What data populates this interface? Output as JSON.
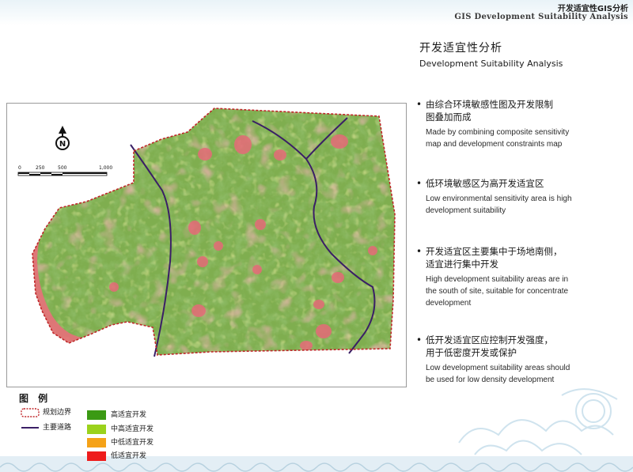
{
  "header": {
    "title_cn": "开发适宜性GIS分析",
    "title_en": "GIS Development Suitability  Analysis"
  },
  "main": {
    "title_cn": "开发适宜性分析",
    "title_en": "Development Suitability Analysis",
    "bullets": [
      {
        "cn_lines": [
          "由综合环境敏感性图及开发限制",
          "图叠加而成"
        ],
        "en_lines": [
          "Made by combining composite sensitivity",
          "map and development constraints map"
        ]
      },
      {
        "cn_lines": [
          "低环境敏感区为高开发适宜区"
        ],
        "en_lines": [
          "Low environmental sensitivity area is high",
          "development suitability"
        ]
      },
      {
        "cn_lines": [
          "开发适宜区主要集中于场地南侧，",
          "适宜进行集中开发"
        ],
        "en_lines": [
          "High development suitability areas are in",
          "the south of site, suitable for concentrate",
          "development"
        ]
      },
      {
        "cn_lines": [
          "低开发适宜区应控制开发强度，",
          "用于低密度开发或保护"
        ],
        "en_lines": [
          "Low development suitability areas should",
          "be used for low density development"
        ]
      }
    ]
  },
  "map": {
    "north_label": "N",
    "scale_labels": [
      "0",
      "250",
      "500",
      "1,000"
    ]
  },
  "legend": {
    "title": "图 例",
    "boundary_label": "规划边界",
    "road_label": "主要道路",
    "classes": [
      {
        "label": "高适宜开发",
        "color": "#3b9a14"
      },
      {
        "label": "中高适宜开发",
        "color": "#9bd21c"
      },
      {
        "label": "中低适宜开发",
        "color": "#f5a218"
      },
      {
        "label": "低适宜开发",
        "color": "#ee1c1c"
      }
    ]
  },
  "colors": {
    "boundary": "#c0262a",
    "road": "#3a1f66",
    "terrain_green": "#7fae4f",
    "low_suitability": "#e8707a"
  }
}
